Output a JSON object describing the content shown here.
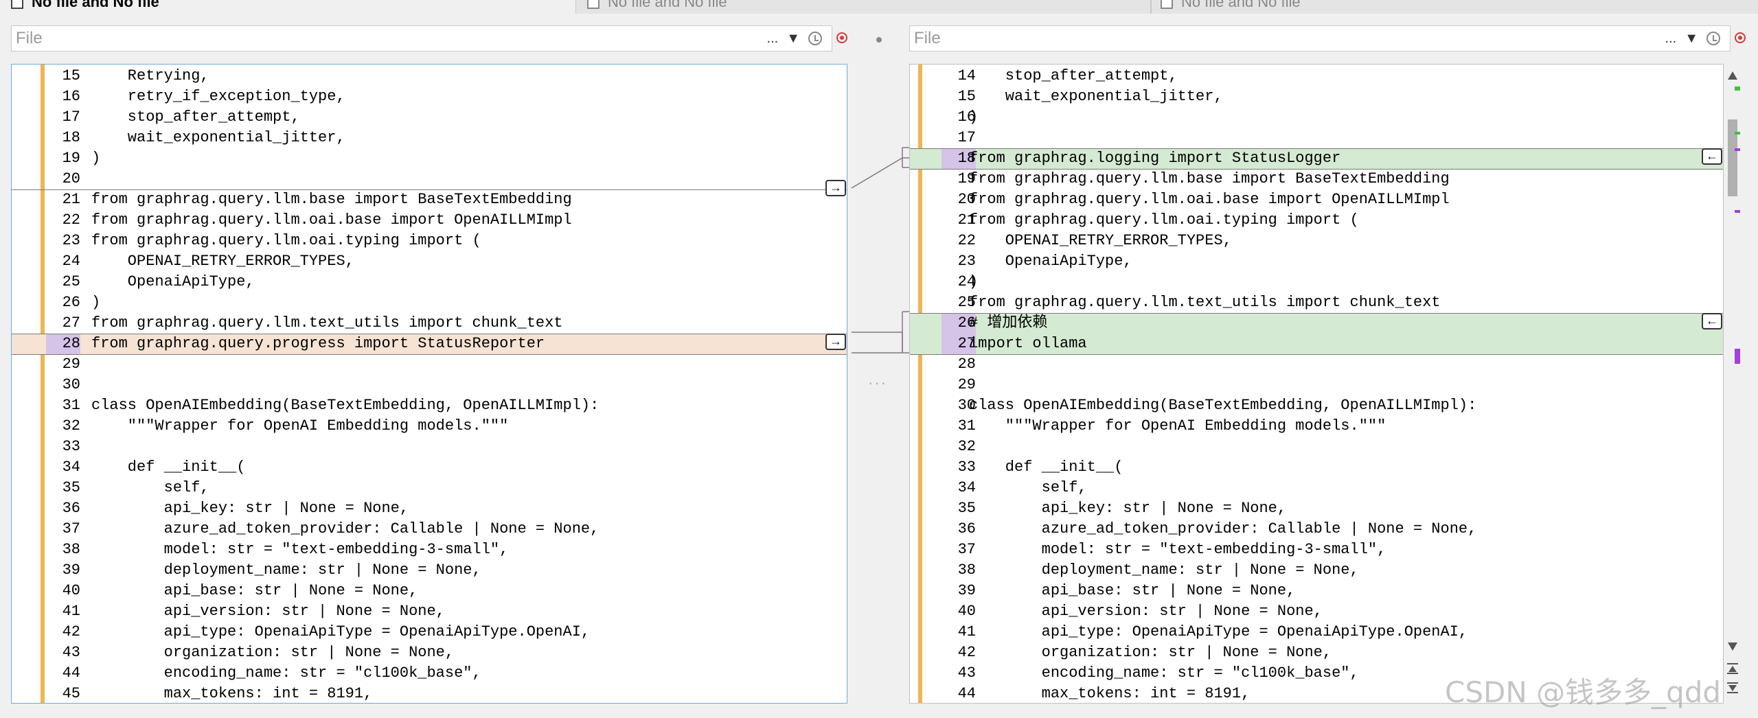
{
  "tabs": [
    {
      "label": "No file and No file",
      "active": true
    },
    {
      "label": "No file and No file",
      "active": false
    },
    {
      "label": "No file and No file",
      "active": false
    }
  ],
  "left_file": {
    "placeholder": "File",
    "menu_label": "..."
  },
  "right_file": {
    "placeholder": "File",
    "menu_label": "..."
  },
  "middle_dots": "···",
  "copy_right_symbol": "→",
  "copy_left_symbol": "←",
  "left_lines": [
    {
      "n": "15",
      "code": "    Retrying,",
      "hl": ""
    },
    {
      "n": "16",
      "code": "    retry_if_exception_type,",
      "hl": ""
    },
    {
      "n": "17",
      "code": "    stop_after_attempt,",
      "hl": ""
    },
    {
      "n": "18",
      "code": "    wait_exponential_jitter,",
      "hl": ""
    },
    {
      "n": "19",
      "code": ")",
      "hl": ""
    },
    {
      "n": "20",
      "code": "",
      "hl": ""
    },
    {
      "n": "21",
      "code": "from graphrag.query.llm.base import BaseTextEmbedding",
      "hl": ""
    },
    {
      "n": "22",
      "code": "from graphrag.query.llm.oai.base import OpenAILLMImpl",
      "hl": ""
    },
    {
      "n": "23",
      "code": "from graphrag.query.llm.oai.typing import (",
      "hl": ""
    },
    {
      "n": "24",
      "code": "    OPENAI_RETRY_ERROR_TYPES,",
      "hl": ""
    },
    {
      "n": "25",
      "code": "    OpenaiApiType,",
      "hl": ""
    },
    {
      "n": "26",
      "code": ")",
      "hl": ""
    },
    {
      "n": "27",
      "code": "from graphrag.query.llm.text_utils import chunk_text",
      "hl": ""
    },
    {
      "n": "28",
      "code": "from graphrag.query.progress import StatusReporter",
      "hl": "del"
    },
    {
      "n": "29",
      "code": "",
      "hl": ""
    },
    {
      "n": "30",
      "code": "",
      "hl": ""
    },
    {
      "n": "31",
      "code": "class OpenAIEmbedding(BaseTextEmbedding, OpenAILLMImpl):",
      "hl": ""
    },
    {
      "n": "32",
      "code": "    \"\"\"Wrapper for OpenAI Embedding models.\"\"\"",
      "hl": ""
    },
    {
      "n": "33",
      "code": "",
      "hl": ""
    },
    {
      "n": "34",
      "code": "    def __init__(",
      "hl": ""
    },
    {
      "n": "35",
      "code": "        self,",
      "hl": ""
    },
    {
      "n": "36",
      "code": "        api_key: str | None = None,",
      "hl": ""
    },
    {
      "n": "37",
      "code": "        azure_ad_token_provider: Callable | None = None,",
      "hl": ""
    },
    {
      "n": "38",
      "code": "        model: str = \"text-embedding-3-small\",",
      "hl": ""
    },
    {
      "n": "39",
      "code": "        deployment_name: str | None = None,",
      "hl": ""
    },
    {
      "n": "40",
      "code": "        api_base: str | None = None,",
      "hl": ""
    },
    {
      "n": "41",
      "code": "        api_version: str | None = None,",
      "hl": ""
    },
    {
      "n": "42",
      "code": "        api_type: OpenaiApiType = OpenaiApiType.OpenAI,",
      "hl": ""
    },
    {
      "n": "43",
      "code": "        organization: str | None = None,",
      "hl": ""
    },
    {
      "n": "44",
      "code": "        encoding_name: str = \"cl100k_base\",",
      "hl": ""
    },
    {
      "n": "45",
      "code": "        max_tokens: int = 8191,",
      "hl": ""
    }
  ],
  "right_lines": [
    {
      "n": "14",
      "code": "    stop_after_attempt,",
      "hl": ""
    },
    {
      "n": "15",
      "code": "    wait_exponential_jitter,",
      "hl": ""
    },
    {
      "n": "16",
      "code": ")",
      "hl": ""
    },
    {
      "n": "17",
      "code": "",
      "hl": ""
    },
    {
      "n": "18",
      "code": "from graphrag.logging import StatusLogger",
      "hl": "add"
    },
    {
      "n": "19",
      "code": "from graphrag.query.llm.base import BaseTextEmbedding",
      "hl": ""
    },
    {
      "n": "20",
      "code": "from graphrag.query.llm.oai.base import OpenAILLMImpl",
      "hl": ""
    },
    {
      "n": "21",
      "code": "from graphrag.query.llm.oai.typing import (",
      "hl": ""
    },
    {
      "n": "22",
      "code": "    OPENAI_RETRY_ERROR_TYPES,",
      "hl": ""
    },
    {
      "n": "23",
      "code": "    OpenaiApiType,",
      "hl": ""
    },
    {
      "n": "24",
      "code": ")",
      "hl": ""
    },
    {
      "n": "25",
      "code": "from graphrag.query.llm.text_utils import chunk_text",
      "hl": ""
    },
    {
      "n": "26",
      "code": "# 增加依赖",
      "hl": "add"
    },
    {
      "n": "27",
      "code": "import ollama",
      "hl": "add"
    },
    {
      "n": "28",
      "code": "",
      "hl": ""
    },
    {
      "n": "29",
      "code": "",
      "hl": ""
    },
    {
      "n": "30",
      "code": "class OpenAIEmbedding(BaseTextEmbedding, OpenAILLMImpl):",
      "hl": ""
    },
    {
      "n": "31",
      "code": "    \"\"\"Wrapper for OpenAI Embedding models.\"\"\"",
      "hl": ""
    },
    {
      "n": "32",
      "code": "",
      "hl": ""
    },
    {
      "n": "33",
      "code": "    def __init__(",
      "hl": ""
    },
    {
      "n": "34",
      "code": "        self,",
      "hl": ""
    },
    {
      "n": "35",
      "code": "        api_key: str | None = None,",
      "hl": ""
    },
    {
      "n": "36",
      "code": "        azure_ad_token_provider: Callable | None = None,",
      "hl": ""
    },
    {
      "n": "37",
      "code": "        model: str = \"text-embedding-3-small\",",
      "hl": ""
    },
    {
      "n": "38",
      "code": "        deployment_name: str | None = None,",
      "hl": ""
    },
    {
      "n": "39",
      "code": "        api_base: str | None = None,",
      "hl": ""
    },
    {
      "n": "40",
      "code": "        api_version: str | None = None,",
      "hl": ""
    },
    {
      "n": "41",
      "code": "        api_type: OpenaiApiType = OpenaiApiType.OpenAI,",
      "hl": ""
    },
    {
      "n": "42",
      "code": "        organization: str | None = None,",
      "hl": ""
    },
    {
      "n": "43",
      "code": "        encoding_name: str = \"cl100k_base\",",
      "hl": ""
    },
    {
      "n": "44",
      "code": "        max_tokens: int = 8191,",
      "hl": ""
    }
  ],
  "colors": {
    "gutter": "#f0b452",
    "added": "#d5ead2",
    "removed": "#f7e3d3",
    "marker_purple": "#a040e0",
    "marker_orange": "#f0a040",
    "marker_green": "#40c040"
  },
  "watermark": "CSDN @钱多多_qdd"
}
